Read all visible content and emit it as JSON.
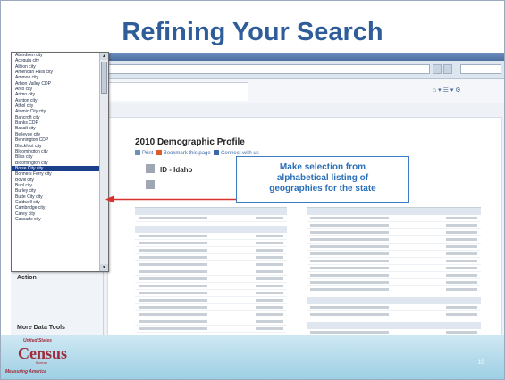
{
  "slide": {
    "title": "Refining Your Search",
    "page_number": "10"
  },
  "browser": {
    "address_url": "",
    "search_placeholder": ""
  },
  "content": {
    "heading": "2010 Demographic Profile",
    "actions": [
      "Print",
      "Bookmark this page",
      "Connect with us"
    ],
    "state_label": "ID - Idaho"
  },
  "geography_list": {
    "items": [
      "Aberdeen city",
      "Acequia city",
      "Albion city",
      "American Falls city",
      "Ammon city",
      "Arbon Valley CDP",
      "Arco city",
      "Arimo city",
      "Ashton city",
      "Athol city",
      "Atomic City city",
      "Bancroft city",
      "Banks CDP",
      "Basalt city",
      "Bellevue city",
      "Bennington CDP",
      "Blackfoot city",
      "Bloomington city",
      "Bliss city",
      "Bloomington city",
      "Boise City city",
      "Bonners Ferry city",
      "Bovill city",
      "Buhl city",
      "Burley city",
      "Butte City city",
      "Caldwell city",
      "Cambridge city",
      "Carey city",
      "Cascade city"
    ],
    "selected_index": 20
  },
  "sidebar": {
    "action_title": "Action",
    "action_text": "",
    "more_tools": "More Data Tools"
  },
  "callout": {
    "lines": [
      "Make selection from",
      "alphabetical listing of",
      "geographies for the state"
    ]
  },
  "footer": {
    "logo_top": "United States",
    "logo_main": "Census",
    "logo_sub": "Bureau",
    "logo_tag": "Measuring America"
  },
  "colors": {
    "title": "#2f5d9a",
    "callout_text": "#2a6fb8",
    "arrow": "#d9322e",
    "selected_row": "#1c3f8a",
    "logo": "#a02a3a"
  }
}
